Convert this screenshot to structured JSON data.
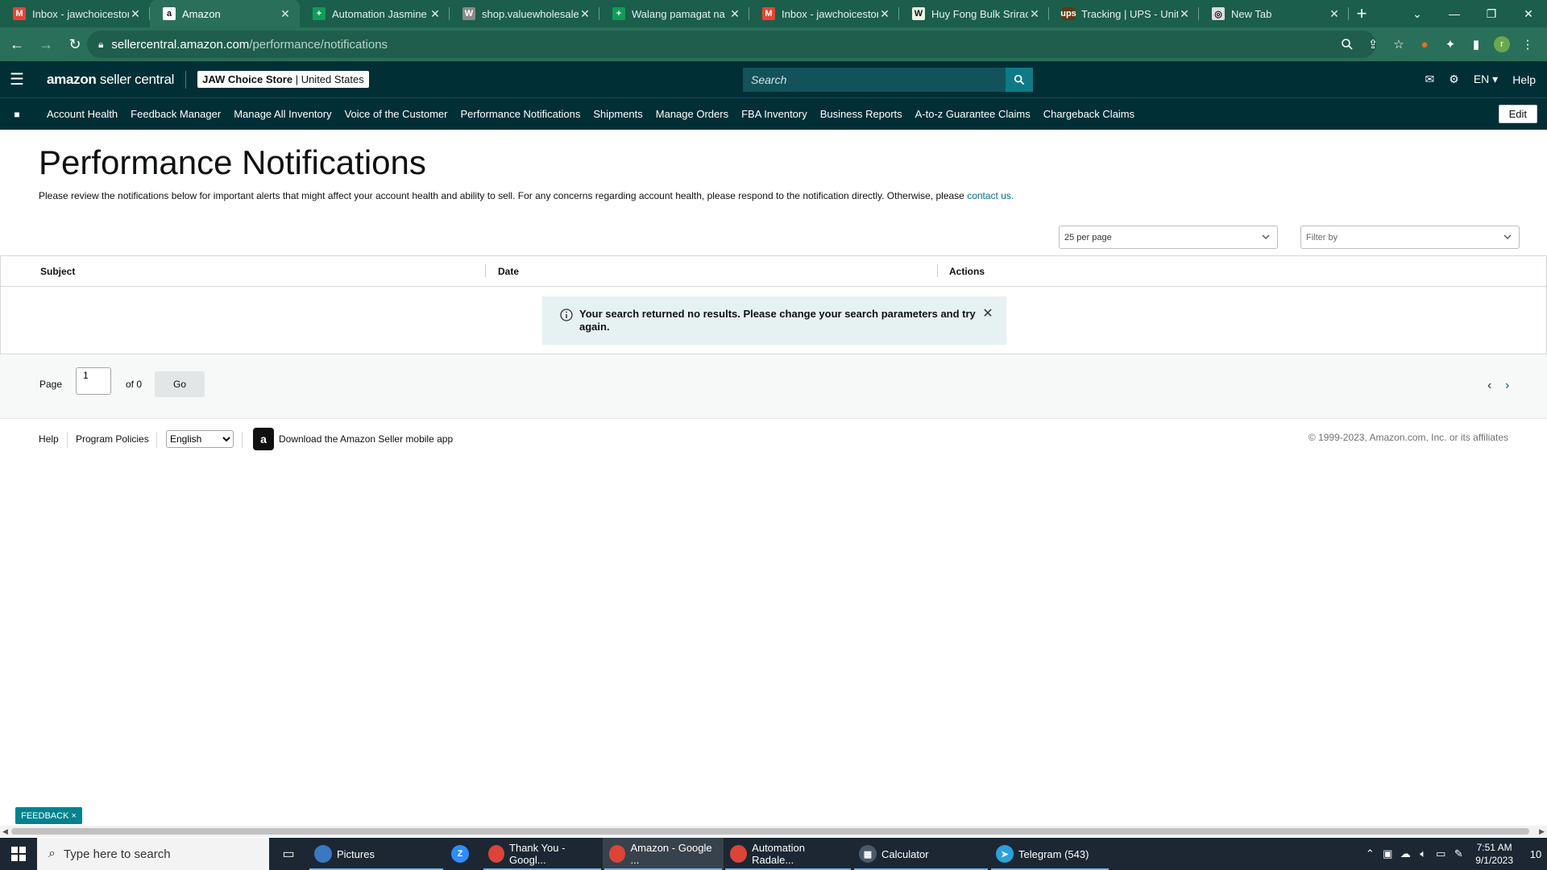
{
  "browser": {
    "tabs": [
      {
        "title": "Inbox - jawchoicestore",
        "icon": "gmail-icon",
        "favColor": "#ea4335",
        "favText": "M",
        "active": false
      },
      {
        "title": "Amazon",
        "icon": "amazon-icon",
        "favColor": "#ffffff",
        "favText": "a",
        "active": true
      },
      {
        "title": "Automation Jasmine W",
        "icon": "sheets-icon",
        "favColor": "#0f9d58",
        "favText": "+",
        "active": false
      },
      {
        "title": "shop.valuewholesale.c",
        "icon": "valuewholesale-icon",
        "favColor": "#8a8a8a",
        "favText": "W",
        "active": false
      },
      {
        "title": "Walang pamagat na sp",
        "icon": "sheets-icon",
        "favColor": "#0f9d58",
        "favText": "+",
        "active": false
      },
      {
        "title": "Inbox - jawchoicestore",
        "icon": "gmail-icon",
        "favColor": "#ea4335",
        "favText": "M",
        "active": false
      },
      {
        "title": "Huy Fong Bulk Sriracha",
        "icon": "huyfong-icon",
        "favColor": "#e9f5e0",
        "favText": "W",
        "active": false
      },
      {
        "title": "Tracking | UPS - United",
        "icon": "ups-icon",
        "favColor": "#5c3a14",
        "favText": "ups",
        "active": false
      },
      {
        "title": "New Tab",
        "icon": "chrome-icon",
        "favColor": "#dddddd",
        "favText": "◎",
        "active": false
      }
    ],
    "url_host": "sellercentral.amazon.com",
    "url_path": "/performance/notifications",
    "profile_initial": "r"
  },
  "header": {
    "logo_amazon": "amazon",
    "logo_sc": " seller central",
    "store_name": "JAW Choice Store",
    "store_sep": " | ",
    "store_region": "United States",
    "search_placeholder": "Search",
    "lang": "EN ▾",
    "help": "Help"
  },
  "nav": {
    "items": [
      "Account Health",
      "Feedback Manager",
      "Manage All Inventory",
      "Voice of the Customer",
      "Performance Notifications",
      "Shipments",
      "Manage Orders",
      "FBA Inventory",
      "Business Reports",
      "A-to-z Guarantee Claims",
      "Chargeback Claims"
    ],
    "edit": "Edit"
  },
  "main": {
    "title": "Performance Notifications",
    "intro_text": "Please review the notifications below for important alerts that might affect your account health and ability to sell. For any concerns regarding account health, please respond to the notification directly. Otherwise, please ",
    "intro_link": "contact us.",
    "per_page": "25 per page",
    "filter_placeholder": "Filter by",
    "columns": {
      "subject": "Subject",
      "date": "Date",
      "actions": "Actions"
    },
    "alert": "Your search returned no results. Please change your search parameters and try again.",
    "pager": {
      "page_label": "Page",
      "page_value": "1",
      "of_label": "of 0",
      "go": "Go"
    }
  },
  "footer": {
    "help": "Help",
    "policies": "Program Policies",
    "language": "English",
    "app_text": "Download the Amazon Seller mobile app",
    "copyright": "© 1999-2023, Amazon.com, Inc. or its affiliates"
  },
  "feedback": "FEEDBACK ×",
  "taskbar": {
    "search_placeholder": "Type here to search",
    "apps": [
      {
        "label": "Pictures",
        "icon": "file-explorer-icon",
        "color": "#3b78c2",
        "txt": "",
        "active": false
      },
      {
        "label": "",
        "icon": "zoom-icon",
        "color": "#2d8cff",
        "txt": "Z",
        "active": false
      },
      {
        "label": "Thank You - Googl...",
        "icon": "chrome-icon",
        "color": "#db4437",
        "txt": "",
        "active": false
      },
      {
        "label": "Amazon - Google ...",
        "icon": "chrome-icon",
        "color": "#db4437",
        "txt": "",
        "active": true
      },
      {
        "label": "Automation Radale...",
        "icon": "chrome-icon",
        "color": "#db4437",
        "txt": "",
        "active": false
      },
      {
        "label": "Calculator",
        "icon": "calculator-icon",
        "color": "#4a5a6a",
        "txt": "▦",
        "active": false
      },
      {
        "label": "Telegram (543)",
        "icon": "telegram-icon",
        "color": "#2aa1da",
        "txt": "➤",
        "active": false
      }
    ],
    "time": "7:51 AM",
    "date": "9/1/2023",
    "notifications": "10"
  }
}
